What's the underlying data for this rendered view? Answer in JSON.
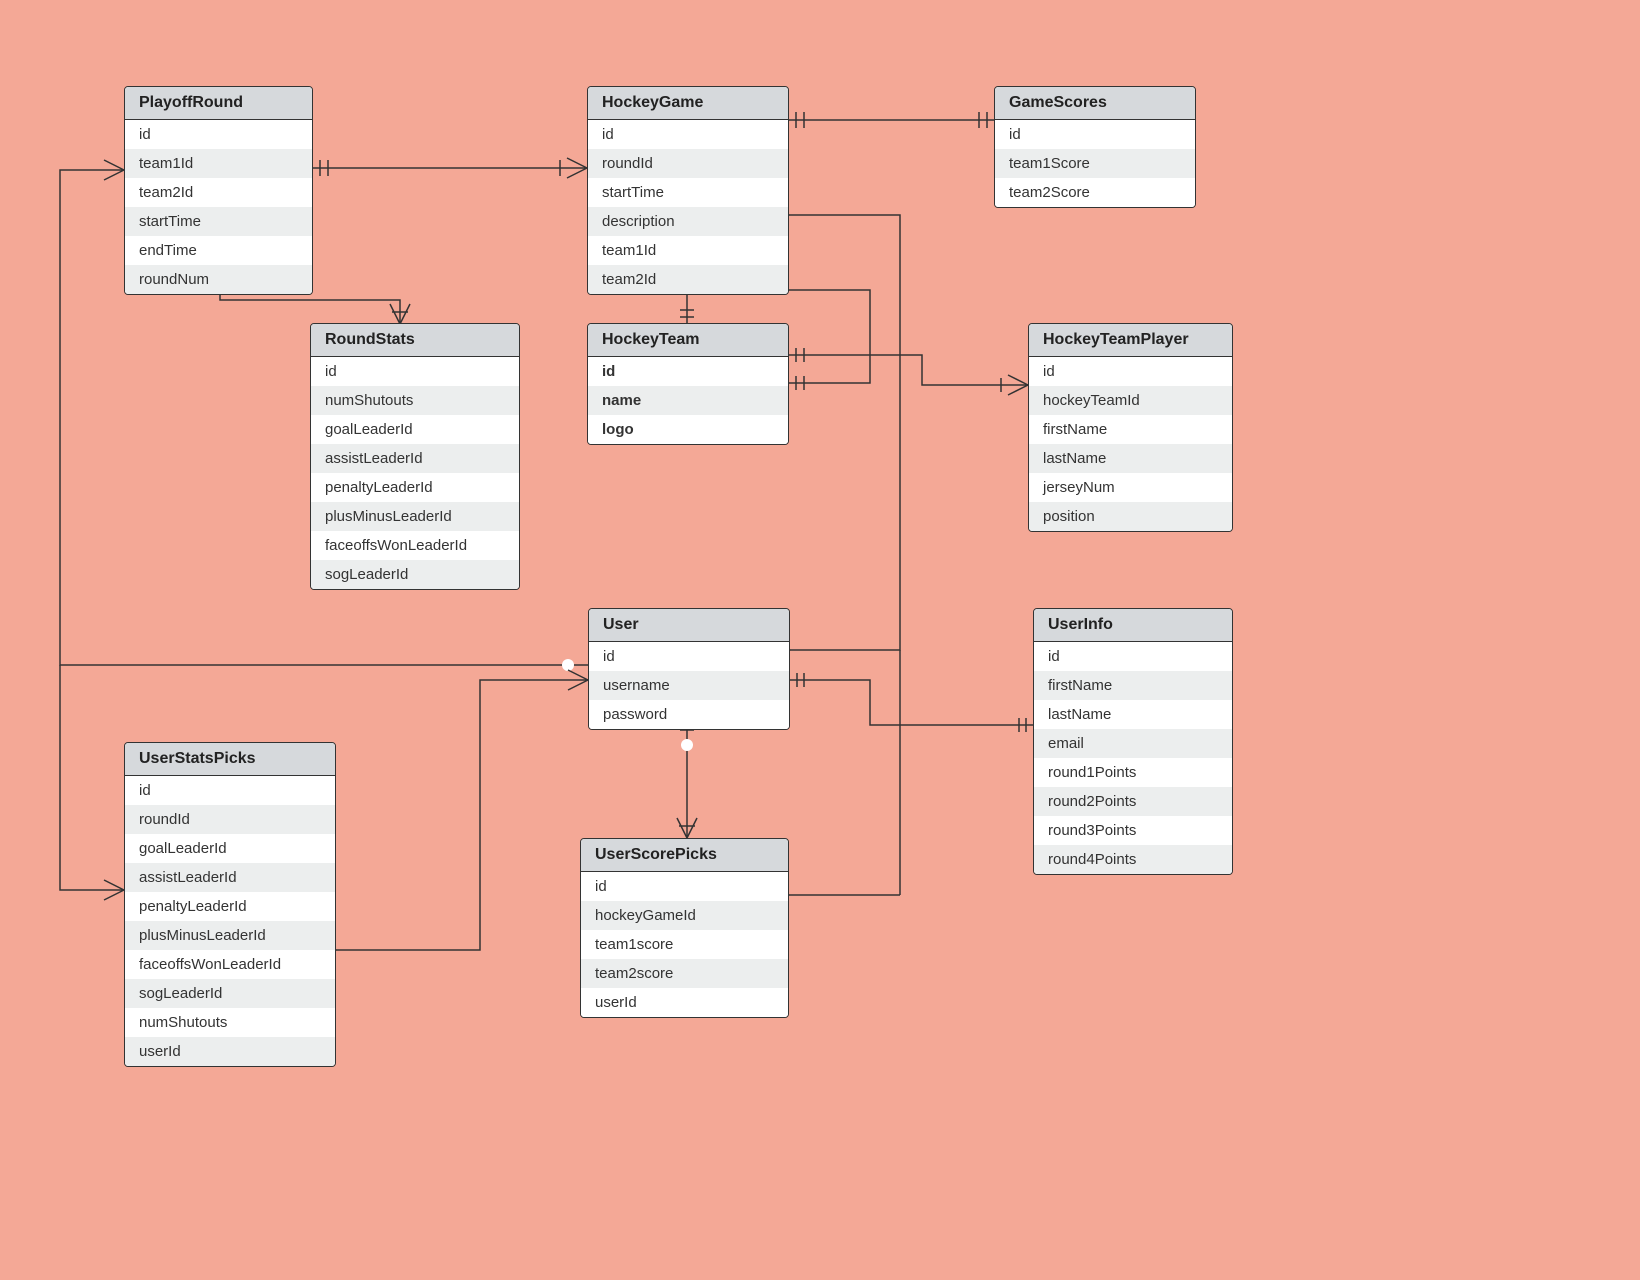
{
  "entities": {
    "PlayoffRound": {
      "title": "PlayoffRound",
      "fields": [
        "id",
        "team1Id",
        "team2Id",
        "startTime",
        "endTime",
        "roundNum"
      ]
    },
    "HockeyGame": {
      "title": "HockeyGame",
      "fields": [
        "id",
        "roundId",
        "startTime",
        "description",
        "team1Id",
        "team2Id"
      ]
    },
    "GameScores": {
      "title": "GameScores",
      "fields": [
        "id",
        "team1Score",
        "team2Score"
      ]
    },
    "RoundStats": {
      "title": "RoundStats",
      "fields": [
        "id",
        "numShutouts",
        "goalLeaderId",
        "assistLeaderId",
        "penaltyLeaderId",
        "plusMinusLeaderId",
        "faceoffsWonLeaderId",
        "sogLeaderId"
      ]
    },
    "HockeyTeam": {
      "title": "HockeyTeam",
      "fields": [
        "id",
        "name",
        "logo"
      ]
    },
    "HockeyTeamPlayer": {
      "title": "HockeyTeamPlayer",
      "fields": [
        "id",
        "hockeyTeamId",
        "firstName",
        "lastName",
        "jerseyNum",
        "position"
      ]
    },
    "User": {
      "title": "User",
      "fields": [
        "id",
        "username",
        "password"
      ]
    },
    "UserInfo": {
      "title": "UserInfo",
      "fields": [
        "id",
        "firstName",
        "lastName",
        "email",
        "round1Points",
        "round2Points",
        "round3Points",
        "round4Points"
      ]
    },
    "UserStatsPicks": {
      "title": "UserStatsPicks",
      "fields": [
        "id",
        "roundId",
        "goalLeaderId",
        "assistLeaderId",
        "penaltyLeaderId",
        "plusMinusLeaderId",
        "faceoffsWonLeaderId",
        "sogLeaderId",
        "numShutouts",
        "userId"
      ]
    },
    "UserScorePicks": {
      "title": "UserScorePicks",
      "fields": [
        "id",
        "hockeyGameId",
        "team1score",
        "team2score",
        "userId"
      ]
    }
  },
  "boldEntities": [
    "HockeyTeam"
  ]
}
